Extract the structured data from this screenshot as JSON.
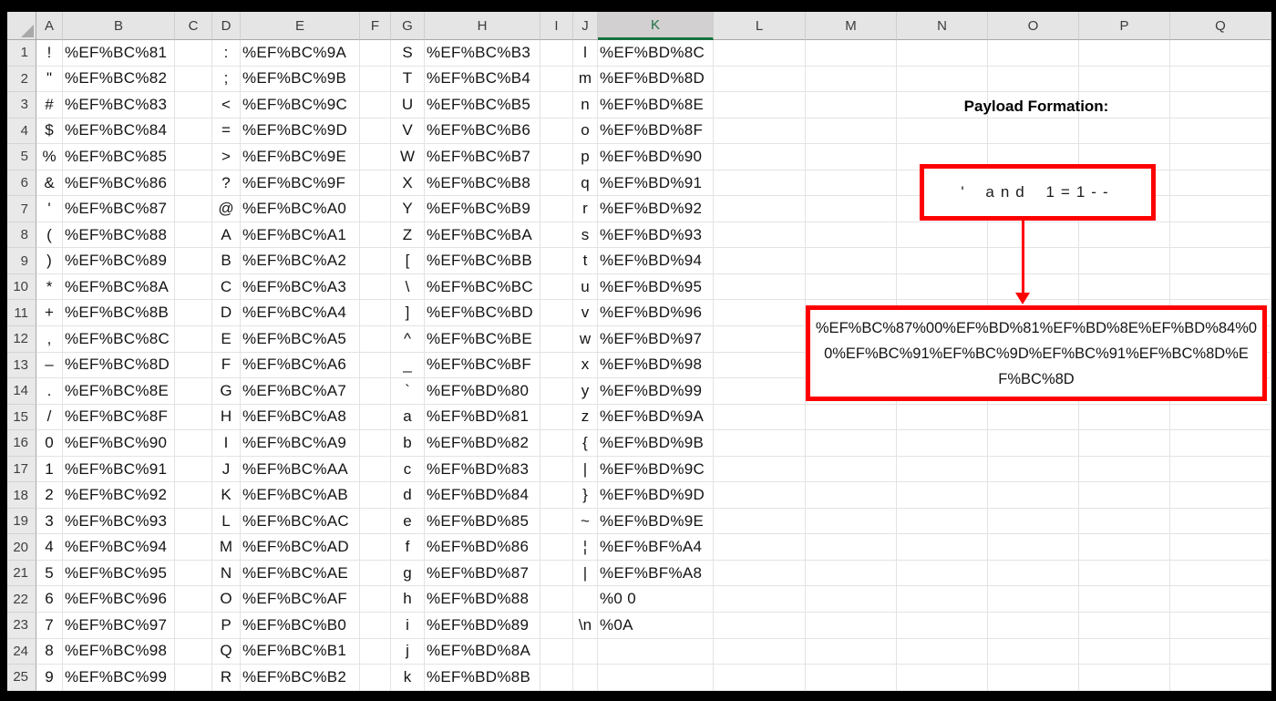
{
  "colors": {
    "accent_red": "#fe0000",
    "selection_green": "#1e7145",
    "header_gray": "#e5e5e5"
  },
  "grid": {
    "column_headers": [
      "A",
      "B",
      "C",
      "D",
      "E",
      "F",
      "G",
      "H",
      "I",
      "J",
      "K",
      "L",
      "M",
      "N",
      "O",
      "P",
      "Q"
    ],
    "selected_column": "K",
    "rows": [
      {
        "n": "1",
        "A": "!",
        "B": "%EF%BC%81",
        "D": ":",
        "E": "%EF%BC%9A",
        "G": "S",
        "H": "%EF%BC%B3",
        "J": "l",
        "K": "%EF%BD%8C"
      },
      {
        "n": "2",
        "A": "\"",
        "B": "%EF%BC%82",
        "D": ";",
        "E": "%EF%BC%9B",
        "G": "T",
        "H": "%EF%BC%B4",
        "J": "m",
        "K": "%EF%BD%8D"
      },
      {
        "n": "3",
        "A": "#",
        "B": "%EF%BC%83",
        "D": "<",
        "E": "%EF%BC%9C",
        "G": "U",
        "H": "%EF%BC%B5",
        "J": "n",
        "K": "%EF%BD%8E"
      },
      {
        "n": "4",
        "A": "$",
        "B": "%EF%BC%84",
        "D": "=",
        "E": "%EF%BC%9D",
        "G": "V",
        "H": "%EF%BC%B6",
        "J": "o",
        "K": "%EF%BD%8F"
      },
      {
        "n": "5",
        "A": "%",
        "B": "%EF%BC%85",
        "D": ">",
        "E": "%EF%BC%9E",
        "G": "W",
        "H": "%EF%BC%B7",
        "J": "p",
        "K": "%EF%BD%90"
      },
      {
        "n": "6",
        "A": "&",
        "B": "%EF%BC%86",
        "D": "?",
        "E": "%EF%BC%9F",
        "G": "X",
        "H": "%EF%BC%B8",
        "J": "q",
        "K": "%EF%BD%91"
      },
      {
        "n": "7",
        "A": "'",
        "B": "%EF%BC%87",
        "D": "@",
        "E": "%EF%BC%A0",
        "G": "Y",
        "H": "%EF%BC%B9",
        "J": "r",
        "K": "%EF%BD%92"
      },
      {
        "n": "8",
        "A": "(",
        "B": "%EF%BC%88",
        "D": "A",
        "E": "%EF%BC%A1",
        "G": "Z",
        "H": "%EF%BC%BA",
        "J": "s",
        "K": "%EF%BD%93"
      },
      {
        "n": "9",
        "A": ")",
        "B": "%EF%BC%89",
        "D": "B",
        "E": "%EF%BC%A2",
        "G": "[",
        "H": "%EF%BC%BB",
        "J": "t",
        "K": "%EF%BD%94"
      },
      {
        "n": "10",
        "A": "*",
        "B": "%EF%BC%8A",
        "D": "C",
        "E": "%EF%BC%A3",
        "G": "\\",
        "H": "%EF%BC%BC",
        "J": "u",
        "K": "%EF%BD%95"
      },
      {
        "n": "11",
        "A": "+",
        "B": "%EF%BC%8B",
        "D": "D",
        "E": "%EF%BC%A4",
        "G": "]",
        "H": "%EF%BC%BD",
        "J": "v",
        "K": "%EF%BD%96"
      },
      {
        "n": "12",
        "A": ",",
        "B": "%EF%BC%8C",
        "D": "E",
        "E": "%EF%BC%A5",
        "G": "^",
        "H": "%EF%BC%BE",
        "J": "w",
        "K": "%EF%BD%97"
      },
      {
        "n": "13",
        "A": "–",
        "B": "%EF%BC%8D",
        "D": "F",
        "E": "%EF%BC%A6",
        "G": "_",
        "H": "%EF%BC%BF",
        "J": "x",
        "K": "%EF%BD%98"
      },
      {
        "n": "14",
        "A": ".",
        "B": "%EF%BC%8E",
        "D": "G",
        "E": "%EF%BC%A7",
        "G": "`",
        "H": "%EF%BD%80",
        "J": "y",
        "K": "%EF%BD%99"
      },
      {
        "n": "15",
        "A": "/",
        "B": "%EF%BC%8F",
        "D": "H",
        "E": "%EF%BC%A8",
        "G": "a",
        "H": "%EF%BD%81",
        "J": "z",
        "K": "%EF%BD%9A"
      },
      {
        "n": "16",
        "A": "0",
        "B": "%EF%BC%90",
        "D": "I",
        "E": "%EF%BC%A9",
        "G": "b",
        "H": "%EF%BD%82",
        "J": "{",
        "K": "%EF%BD%9B"
      },
      {
        "n": "17",
        "A": "1",
        "B": "%EF%BC%91",
        "D": "J",
        "E": "%EF%BC%AA",
        "G": "c",
        "H": "%EF%BD%83",
        "J": "|",
        "K": "%EF%BD%9C"
      },
      {
        "n": "18",
        "A": "2",
        "B": "%EF%BC%92",
        "D": "K",
        "E": "%EF%BC%AB",
        "G": "d",
        "H": "%EF%BD%84",
        "J": "}",
        "K": "%EF%BD%9D"
      },
      {
        "n": "19",
        "A": "3",
        "B": "%EF%BC%93",
        "D": "L",
        "E": "%EF%BC%AC",
        "G": "e",
        "H": "%EF%BD%85",
        "J": "~",
        "K": "%EF%BD%9E"
      },
      {
        "n": "20",
        "A": "4",
        "B": "%EF%BC%94",
        "D": "M",
        "E": "%EF%BC%AD",
        "G": "f",
        "H": "%EF%BD%86",
        "J": "¦",
        "K": "%EF%BF%A4"
      },
      {
        "n": "21",
        "A": "5",
        "B": "%EF%BC%95",
        "D": "N",
        "E": "%EF%BC%AE",
        "G": "g",
        "H": "%EF%BD%87",
        "J": "|",
        "K": "%EF%BF%A8"
      },
      {
        "n": "22",
        "A": "6",
        "B": "%EF%BC%96",
        "D": "O",
        "E": "%EF%BC%AF",
        "G": "h",
        "H": "%EF%BD%88",
        "J": "",
        "K": "%0 0"
      },
      {
        "n": "23",
        "A": "7",
        "B": "%EF%BC%97",
        "D": "P",
        "E": "%EF%BC%B0",
        "G": "i",
        "H": "%EF%BD%89",
        "J": "\\n",
        "K": "%0A"
      },
      {
        "n": "24",
        "A": "8",
        "B": "%EF%BC%98",
        "D": "Q",
        "E": "%EF%BC%B1",
        "G": "j",
        "H": "%EF%BD%8A"
      },
      {
        "n": "25",
        "A": "9",
        "B": "%EF%BC%99",
        "D": "R",
        "E": "%EF%BC%B2",
        "G": "k",
        "H": "%EF%BD%8B"
      }
    ]
  },
  "annotation": {
    "title": "Payload Formation:",
    "payload_plain": "' and 1=1--",
    "payload_encoded": "%EF%BC%87%00%EF%BD%81%EF%BD%8E%EF%BD%84%00%EF%BC%91%EF%BC%9D%EF%BC%91%EF%BC%8D%EF%BC%8D"
  }
}
